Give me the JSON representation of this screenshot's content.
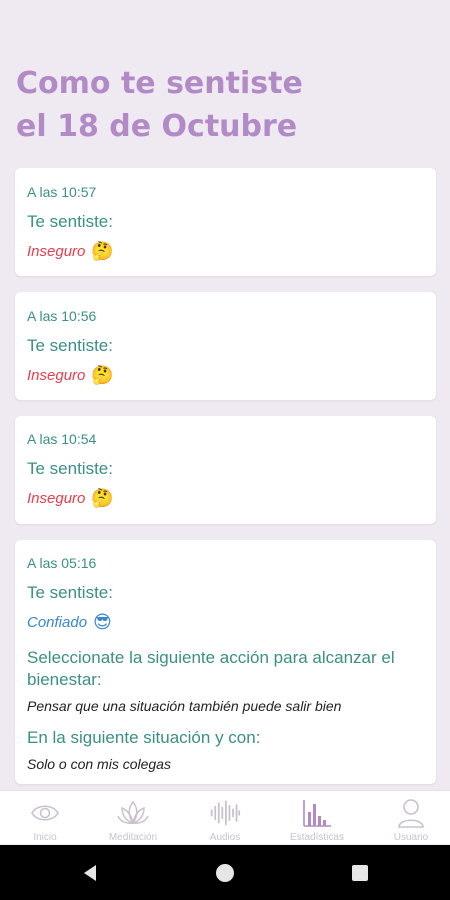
{
  "header": {
    "title_line1": "Como te sentiste",
    "title_line2": "el 18 de Octubre"
  },
  "entries": [
    {
      "time": "A las 10:57",
      "felt_label": "Te sentiste:",
      "emotion": "Inseguro",
      "emoji": "🤔"
    },
    {
      "time": "A las 10:56",
      "felt_label": "Te sentiste:",
      "emotion": "Inseguro",
      "emoji": "🤔"
    },
    {
      "time": "A las 10:54",
      "felt_label": "Te sentiste:",
      "emotion": "Inseguro",
      "emoji": "🤔"
    },
    {
      "time": "A las 05:16",
      "felt_label": "Te sentiste:",
      "emotion": "Confiado",
      "emoji": "😎",
      "action_label": "Seleccionate la siguiente acción para alcanzar el bienestar:",
      "action_value": "Pensar que una situación también puede salir bien",
      "situation_label": "En la siguiente situación y con:",
      "situation_value": "Solo o con mis colegas"
    }
  ],
  "bottom_nav": {
    "items": [
      {
        "label": "Inicio",
        "icon": "home-icon"
      },
      {
        "label": "Meditación",
        "icon": "lotus-icon"
      },
      {
        "label": "Audios",
        "icon": "soundwave-icon"
      },
      {
        "label": "Estadísticas",
        "icon": "bar-chart-icon"
      },
      {
        "label": "Usuario",
        "icon": "user-icon"
      }
    ]
  },
  "colors": {
    "background": "#efe9f2",
    "title": "#b18ac6",
    "teal_text": "#3a8f86",
    "negative": "#ea3c4b",
    "positive": "#3a87cf",
    "nav_inactive": "#c8c0cf",
    "nav_active": "#b18ac6"
  }
}
